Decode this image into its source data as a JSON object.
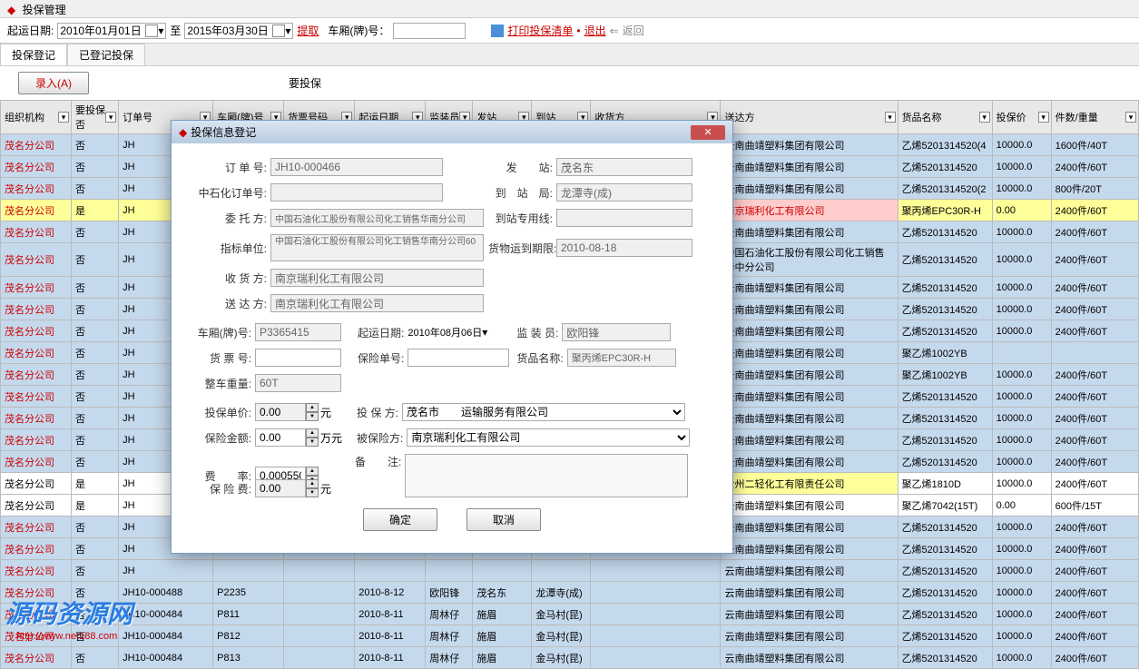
{
  "title": "投保管理",
  "toolbar": {
    "start_date_label": "起运日期:",
    "start_date": "2010年01月01日",
    "to": "至",
    "end_date": "2015年03月30日",
    "extract": "提取",
    "car_number_label": "车厢(牌)号：",
    "print": "打印投保清单",
    "exit": "退出",
    "back": "返回"
  },
  "tabs": {
    "t1": "投保登记",
    "t2": "已登记投保"
  },
  "sub_toolbar": {
    "entry": "录入(A)",
    "need_insure": "要投保"
  },
  "columns": [
    "组织机构",
    "要投保否",
    "订单号",
    "车厢(牌)号",
    "货票号码",
    "起运日期",
    "监装员",
    "发站",
    "到站",
    "收货方",
    "送达方",
    "货品名称",
    "投保价",
    "件数/重量"
  ],
  "rows": [
    {
      "org": "茂名分公司",
      "insure": "否",
      "order": "JH",
      "delivery": "云南曲靖塑料集团有限公司",
      "product": "乙烯5201314520(4",
      "price": "10000.0",
      "qty": "1600件/40T",
      "cls": "blue"
    },
    {
      "org": "茂名分公司",
      "insure": "否",
      "order": "JH",
      "delivery": "云南曲靖塑料集团有限公司",
      "product": "乙烯5201314520",
      "price": "10000.0",
      "qty": "2400件/60T",
      "cls": "blue"
    },
    {
      "org": "茂名分公司",
      "insure": "否",
      "order": "JH",
      "delivery": "云南曲靖塑料集团有限公司",
      "product": "乙烯5201314520(2",
      "price": "10000.0",
      "qty": "800件/20T",
      "cls": "blue"
    },
    {
      "org": "茂名分公司",
      "insure": "是",
      "order": "JH",
      "delivery": "南京瑞利化工有限公司",
      "product": "聚丙烯EPC30R-H",
      "price": "0.00",
      "qty": "2400件/60T",
      "cls": "yellow",
      "dcls": "red-cell"
    },
    {
      "org": "茂名分公司",
      "insure": "否",
      "order": "JH",
      "delivery": "云南曲靖塑料集团有限公司",
      "product": "乙烯5201314520",
      "price": "10000.0",
      "qty": "2400件/60T",
      "cls": "blue"
    },
    {
      "org": "茂名分公司",
      "insure": "否",
      "order": "JH",
      "delivery": "中国石油化工股份有限公司化工销售华中分公司",
      "product": "乙烯5201314520",
      "price": "10000.0",
      "qty": "2400件/60T",
      "cls": "blue"
    },
    {
      "org": "茂名分公司",
      "insure": "否",
      "order": "JH",
      "delivery": "云南曲靖塑料集团有限公司",
      "product": "乙烯5201314520",
      "price": "10000.0",
      "qty": "2400件/60T",
      "cls": "blue"
    },
    {
      "org": "茂名分公司",
      "insure": "否",
      "order": "JH",
      "delivery": "云南曲靖塑料集团有限公司",
      "product": "乙烯5201314520",
      "price": "10000.0",
      "qty": "2400件/60T",
      "cls": "blue"
    },
    {
      "org": "茂名分公司",
      "insure": "否",
      "order": "JH",
      "delivery": "云南曲靖塑料集团有限公司",
      "product": "乙烯5201314520",
      "price": "10000.0",
      "qty": "2400件/60T",
      "cls": "blue"
    },
    {
      "org": "茂名分公司",
      "insure": "否",
      "order": "JH",
      "delivery": "云南曲靖塑料集团有限公司",
      "product": "聚乙烯1002YB",
      "price": "",
      "qty": "",
      "cls": "blue"
    },
    {
      "org": "茂名分公司",
      "insure": "否",
      "order": "JH",
      "delivery": "云南曲靖塑料集团有限公司",
      "product": "聚乙烯1002YB",
      "price": "10000.0",
      "qty": "2400件/60T",
      "cls": "blue"
    },
    {
      "org": "茂名分公司",
      "insure": "否",
      "order": "JH",
      "delivery": "云南曲靖塑料集团有限公司",
      "product": "乙烯5201314520",
      "price": "10000.0",
      "qty": "2400件/60T",
      "cls": "blue"
    },
    {
      "org": "茂名分公司",
      "insure": "否",
      "order": "JH",
      "delivery": "云南曲靖塑料集团有限公司",
      "product": "乙烯5201314520",
      "price": "10000.0",
      "qty": "2400件/60T",
      "cls": "blue"
    },
    {
      "org": "茂名分公司",
      "insure": "否",
      "order": "JH",
      "delivery": "云南曲靖塑料集团有限公司",
      "product": "乙烯5201314520",
      "price": "10000.0",
      "qty": "2400件/60T",
      "cls": "blue"
    },
    {
      "org": "茂名分公司",
      "insure": "否",
      "order": "JH",
      "delivery": "云南曲靖塑料集团有限公司",
      "product": "乙烯5201314520",
      "price": "10000.0",
      "qty": "2400件/60T",
      "cls": "blue"
    },
    {
      "org": "茂名分公司",
      "insure": "是",
      "order": "JH",
      "delivery": "贵州二轻化工有限责任公司",
      "product": "聚乙烯1810D",
      "price": "10000.0",
      "qty": "2400件/60T",
      "cls": "",
      "dcls": "yellow-cell"
    },
    {
      "org": "茂名分公司",
      "insure": "是",
      "order": "JH",
      "delivery": "云南曲靖塑料集团有限公司",
      "product": "聚乙烯7042(15T)",
      "price": "0.00",
      "qty": "600件/15T",
      "cls": ""
    },
    {
      "org": "茂名分公司",
      "insure": "否",
      "order": "JH",
      "delivery": "云南曲靖塑料集团有限公司",
      "product": "乙烯5201314520",
      "price": "10000.0",
      "qty": "2400件/60T",
      "cls": "blue"
    },
    {
      "org": "茂名分公司",
      "insure": "否",
      "order": "JH",
      "delivery": "云南曲靖塑料集团有限公司",
      "product": "乙烯5201314520",
      "price": "10000.0",
      "qty": "2400件/60T",
      "cls": "blue"
    },
    {
      "org": "茂名分公司",
      "insure": "否",
      "order": "JH",
      "delivery": "云南曲靖塑料集团有限公司",
      "product": "乙烯5201314520",
      "price": "10000.0",
      "qty": "2400件/60T",
      "cls": "blue"
    },
    {
      "org": "茂名分公司",
      "insure": "否",
      "order": "JH10-000488",
      "car": "P2235",
      "date": "2010-8-12",
      "loader": "欧阳锋",
      "from": "茂名东",
      "to": "龙潭寺(成)",
      "recv": "",
      "delivery": "云南曲靖塑料集团有限公司",
      "product": "乙烯5201314520",
      "price": "10000.0",
      "qty": "2400件/60T",
      "cls": "blue"
    },
    {
      "org": "茂名分公司",
      "insure": "否",
      "order": "JH10-000484",
      "car": "P811",
      "date": "2010-8-11",
      "loader": "周林仔",
      "from": "施眉",
      "to": "金马村(昆)",
      "recv": "",
      "delivery": "云南曲靖塑料集团有限公司",
      "product": "乙烯5201314520",
      "price": "10000.0",
      "qty": "2400件/60T",
      "cls": "blue"
    },
    {
      "org": "茂名分公司",
      "insure": "否",
      "order": "JH10-000484",
      "car": "P812",
      "date": "2010-8-11",
      "loader": "周林仔",
      "from": "施眉",
      "to": "金马村(昆)",
      "recv": "",
      "delivery": "云南曲靖塑料集团有限公司",
      "product": "乙烯5201314520",
      "price": "10000.0",
      "qty": "2400件/60T",
      "cls": "blue"
    },
    {
      "org": "茂名分公司",
      "insure": "否",
      "order": "JH10-000484",
      "car": "P813",
      "date": "2010-8-11",
      "loader": "周林仔",
      "from": "施眉",
      "to": "金马村(昆)",
      "recv": "",
      "delivery": "云南曲靖塑料集团有限公司",
      "product": "乙烯5201314520",
      "price": "10000.0",
      "qty": "2400件/60T",
      "cls": "blue"
    }
  ],
  "modal": {
    "title": "投保信息登记",
    "labels": {
      "order_no": "订 单 号:",
      "sinopec_order": "中石化订单号:",
      "entrust": "委 托 方:",
      "indicator": "指标单位:",
      "receiver": "收 货 方:",
      "sender": "送 达 方:",
      "from_station": "发　　站:",
      "to_station": "到　站　局:",
      "special_line": "到站专用线:",
      "cargo_deadline": "货物运到期限:",
      "car_no": "车厢(牌)号:",
      "depart_date": "起运日期:",
      "supervisor": "监 装 员:",
      "ticket_no": "货 票 号:",
      "policy_no": "保险单号:",
      "product_name": "货品名称:",
      "whole_weight": "整车重量:",
      "insure_price": "投保单价:",
      "insure_amount": "保险金额:",
      "rate": "费　　率:",
      "fee": "保 险 费:",
      "insurer": "投 保 方:",
      "insured": "被保险方:",
      "remark": "备　　注:"
    },
    "values": {
      "order_no": "JH10-000466",
      "sinopec_order": "",
      "entrust": "中国石油化工股份有限公司化工销售华南分公司",
      "indicator": "中国石油化工股份有限公司化工销售华南分公司60",
      "receiver": "南京瑞利化工有限公司",
      "sender": "南京瑞利化工有限公司",
      "from_station": "茂名东",
      "to_station": "龙潭寺(成)",
      "special_line": "",
      "cargo_deadline": "2010-08-18",
      "car_no": "P3365415",
      "depart_date": "2010年08月06日",
      "supervisor": "欧阳锋",
      "ticket_no": "",
      "policy_no": "",
      "product_name": "聚丙烯EPC30R-H",
      "whole_weight": "60T",
      "insure_price": "0.00",
      "insure_amount": "0.00",
      "rate": "0.000550",
      "fee": "0.00",
      "insurer": "茂名市　　运输服务有限公司",
      "insured": "南京瑞利化工有限公司",
      "remark": ""
    },
    "units": {
      "yuan": "元",
      "wan": "万元"
    },
    "buttons": {
      "ok": "确定",
      "cancel": "取消"
    }
  },
  "watermark": {
    "text": "源码资源网",
    "url": "http://www.net188.com"
  }
}
